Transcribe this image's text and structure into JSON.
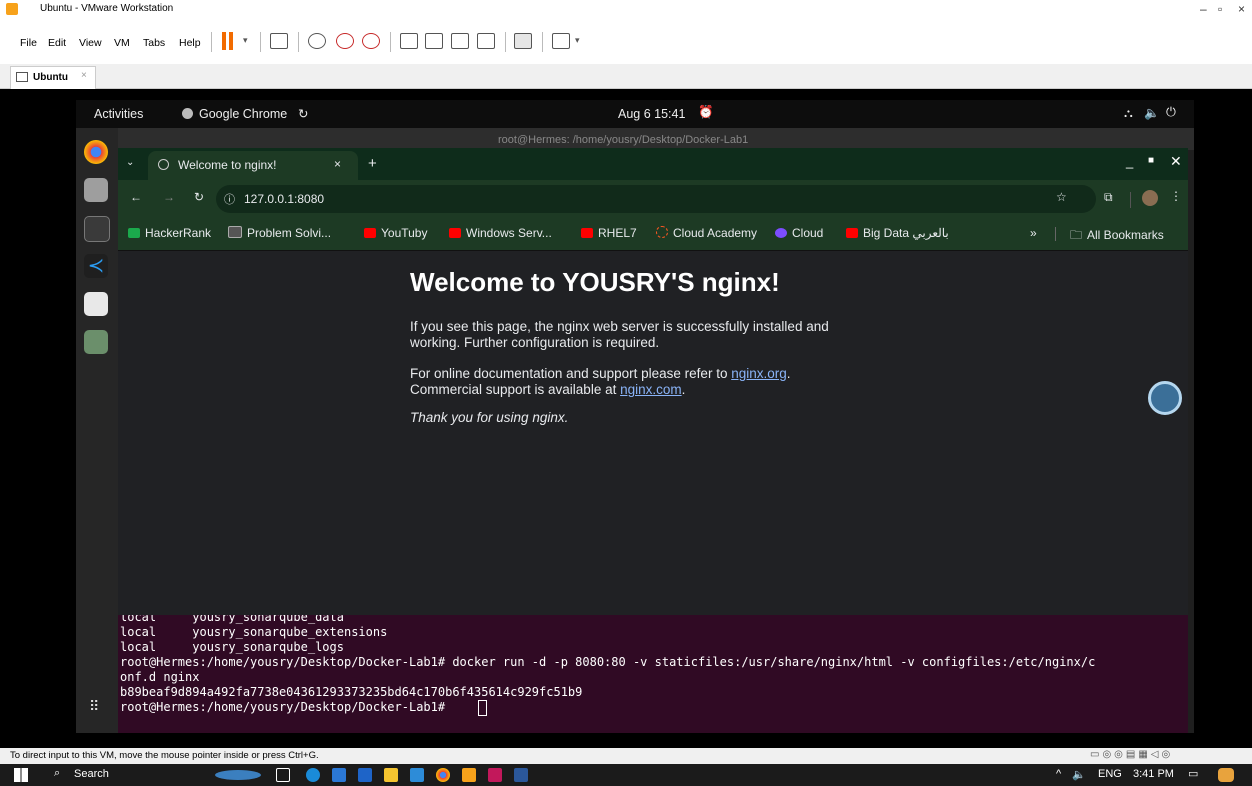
{
  "vmware": {
    "window_title": "Ubuntu - VMware Workstation",
    "menu": [
      "File",
      "Edit",
      "View",
      "VM",
      "Tabs",
      "Help"
    ],
    "tab_label": "Ubuntu",
    "status_message": "To direct input to this VM, move the mouse pointer inside or press Ctrl+G."
  },
  "gnome": {
    "activities": "Activities",
    "app_name": "Google Chrome",
    "datetime": "Aug 6  15:41"
  },
  "terminal_behind_title": "root@Hermes: /home/yousry/Desktop/Docker-Lab1",
  "chrome": {
    "tab_title": "Welcome to nginx!",
    "url": "127.0.0.1:8080",
    "bookmarks": [
      {
        "label": "HackerRank",
        "color": "#1ba94c"
      },
      {
        "label": "Problem Solvi...",
        "color": "#555555"
      },
      {
        "label": "YouTuby",
        "color": "#ff0000"
      },
      {
        "label": "Windows Serv...",
        "color": "#ff0000"
      },
      {
        "label": "RHEL7",
        "color": "#ff0000"
      },
      {
        "label": "Cloud Academy",
        "color": "#ff5722"
      },
      {
        "label": "Cloud",
        "color": "#7c4dff"
      },
      {
        "label": "Big Data بالعربي",
        "color": "#ff0000"
      }
    ],
    "more_bookmarks": "»",
    "all_bookmarks": "All Bookmarks"
  },
  "nginx_page": {
    "heading": "Welcome to YOUSRY'S nginx!",
    "para1": "If you see this page, the nginx web server is successfully installed and working. Further configuration is required.",
    "para2_prefix": "For online documentation and support please refer to ",
    "link1": "nginx.org",
    "para2_mid": ".",
    "para2_line2_prefix": "Commercial support is available at ",
    "link2": "nginx.com",
    "para2_suffix": ".",
    "thanks": "Thank you for using nginx."
  },
  "terminal": {
    "lines": [
      "local     yousry_sonarqube_data",
      "local     yousry_sonarqube_extensions",
      "local     yousry_sonarqube_logs",
      "root@Hermes:/home/yousry/Desktop/Docker-Lab1# docker run -d -p 8080:80 -v staticfiles:/usr/share/nginx/html -v configfiles:/etc/nginx/c",
      "onf.d nginx",
      "b89beaf9d894a492fa7738e04361293373235bd64c170b6f435614c929fc51b9",
      "root@Hermes:/home/yousry/Desktop/Docker-Lab1# "
    ]
  },
  "taskbar": {
    "search": "Search",
    "lang": "ENG",
    "time": "3:41 PM"
  },
  "colors": {
    "chrome_frame": "#1d3a24",
    "terminal_bg": "#300a24",
    "link": "#8ab4f8"
  }
}
